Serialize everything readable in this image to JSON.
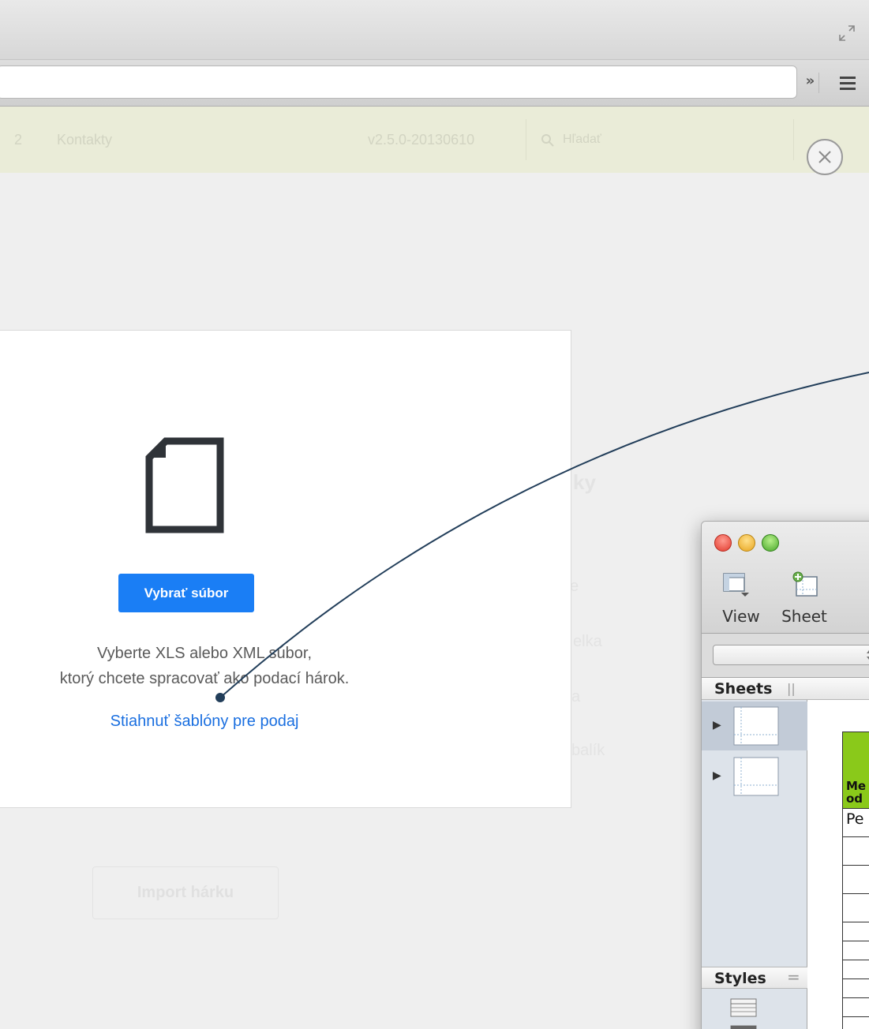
{
  "browser": {
    "icons": {
      "fullscreen": "fullscreen-arrows-icon",
      "menu": "hamburger-menu-icon"
    },
    "overflow_label": "»"
  },
  "app_header": {
    "nav_number": "2",
    "nav_contacts": "Kontakty",
    "version": "v2.5.0-20130610",
    "search_placeholder": "Hľadať"
  },
  "background_ghost": {
    "items": [
      "ky",
      "e",
      "elka",
      "a",
      "balík"
    ],
    "import_button": "Import hárku"
  },
  "dialog": {
    "choose_file_button": "Vybrať súbor",
    "instructions_line1": "Vyberte XLS alebo XML súbor,",
    "instructions_line2": "ktorý chcete spracovať ako podací hárok.",
    "download_templates_link": "Stiahnuť šablóny pre podaj",
    "colors": {
      "button": "#1a7ef5",
      "link": "#1a6fe0"
    }
  },
  "numbers_app": {
    "toolbar": {
      "view_label": "View",
      "sheet_label": "Sheet"
    },
    "sidebar": {
      "sheets_label": "Sheets",
      "styles_label": "Styles",
      "sheets_grip": "||",
      "styles_grip": "="
    },
    "sheet_items": [
      "sheet-1",
      "sheet-2"
    ],
    "table": {
      "header_line1": "Me",
      "header_line2": "od",
      "first_cell": "Pe",
      "header_color": "#8ac91a"
    }
  }
}
